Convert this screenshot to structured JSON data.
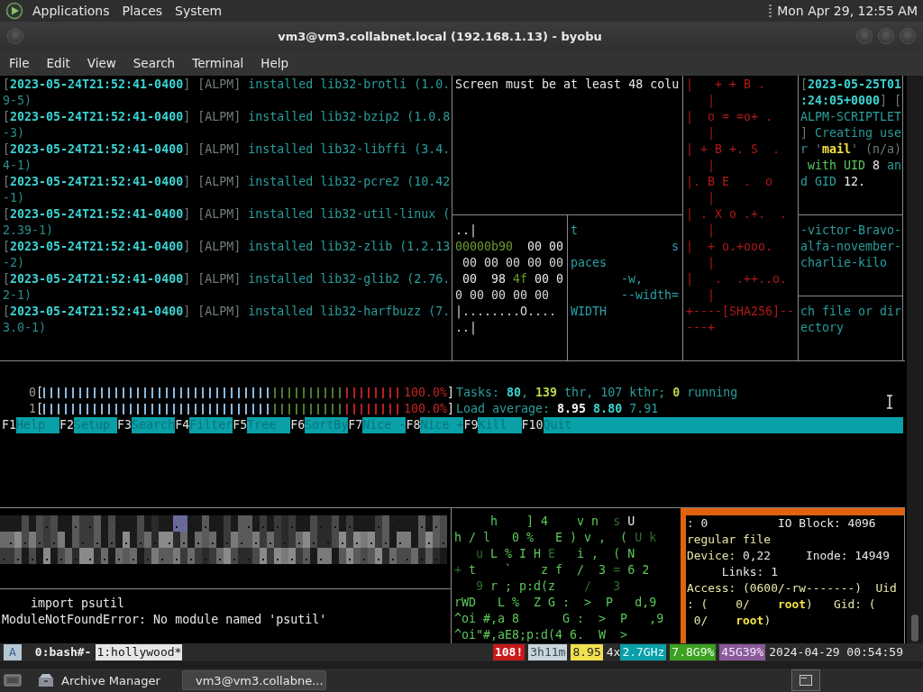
{
  "top_panel": {
    "menus": [
      "Applications",
      "Places",
      "System"
    ],
    "clock": "Mon Apr 29, 12:55 AM"
  },
  "window": {
    "title": "vm3@vm3.collabnet.local (192.168.1.13) - byobu"
  },
  "menu_bar": [
    "File",
    "Edit",
    "View",
    "Search",
    "Terminal",
    "Help"
  ],
  "terminal": {
    "log_pane": {
      "lines": [
        [
          {
            "kind": "grey",
            "text": "["
          },
          {
            "kind": "ts",
            "text": "2023-05-24T21:52:41-0400"
          },
          {
            "kind": "grey",
            "text": "] [ALPM]"
          },
          {
            "kind": "teal",
            "text": " installed lib32-brotli (1.0."
          }
        ],
        "9-5)",
        [
          {
            "kind": "grey",
            "text": "["
          },
          {
            "kind": "ts",
            "text": "2023-05-24T21:52:41-0400"
          },
          {
            "kind": "grey",
            "text": "] [ALPM]"
          },
          {
            "kind": "teal",
            "text": " installed lib32-bzip2 (1.0.8"
          }
        ],
        "-3)",
        [
          {
            "kind": "grey",
            "text": "["
          },
          {
            "kind": "ts",
            "text": "2023-05-24T21:52:41-0400"
          },
          {
            "kind": "grey",
            "text": "] [ALPM]"
          },
          {
            "kind": "teal",
            "text": " installed lib32-libffi (3.4."
          }
        ],
        "4-1)",
        [
          {
            "kind": "grey",
            "text": "["
          },
          {
            "kind": "ts",
            "text": "2023-05-24T21:52:41-0400"
          },
          {
            "kind": "grey",
            "text": "] [ALPM]"
          },
          {
            "kind": "teal",
            "text": " installed lib32-pcre2 (10.42"
          }
        ],
        "-1)",
        [
          {
            "kind": "grey",
            "text": "["
          },
          {
            "kind": "ts",
            "text": "2023-05-24T21:52:41-0400"
          },
          {
            "kind": "grey",
            "text": "] [ALPM]"
          },
          {
            "kind": "teal",
            "text": " installed lib32-util-linux ("
          }
        ],
        "2.39-1)",
        [
          {
            "kind": "grey",
            "text": "["
          },
          {
            "kind": "ts",
            "text": "2023-05-24T21:52:41-0400"
          },
          {
            "kind": "grey",
            "text": "] [ALPM]"
          },
          {
            "kind": "teal",
            "text": " installed lib32-zlib (1.2.13"
          }
        ],
        "-2)",
        [
          {
            "kind": "grey",
            "text": "["
          },
          {
            "kind": "ts",
            "text": "2023-05-24T21:52:41-0400"
          },
          {
            "kind": "grey",
            "text": "] [ALPM]"
          },
          {
            "kind": "teal",
            "text": " installed lib32-glib2 (2.76."
          }
        ],
        "2-1)",
        [
          {
            "kind": "grey",
            "text": "["
          },
          {
            "kind": "ts",
            "text": "2023-05-24T21:52:41-0400"
          },
          {
            "kind": "grey",
            "text": "] [ALPM]"
          },
          {
            "kind": "teal",
            "text": " installed lib32-harfbuzz (7."
          }
        ],
        "3.0-1)"
      ]
    },
    "screen_pane": {
      "lines": [
        "Screen must be at least 48 colu"
      ]
    },
    "hexdump_pane": {
      "lines": [
        "..|",
        [
          {
            "kind": "olive",
            "text": "00000b90"
          },
          {
            "kind": "white",
            "text": "  00 00"
          }
        ],
        " 00 00 00 00 00",
        [
          {
            "kind": "white",
            "text": " 00  98 "
          },
          {
            "kind": "olive",
            "text": "4f"
          },
          {
            "kind": "white",
            "text": " 00 0"
          }
        ],
        "0 00 00 00 00",
        "|........O....",
        "..|"
      ]
    },
    "manpage_pane": {
      "lines": [
        "t",
        "              s",
        "paces",
        "       -w,",
        "       --width=",
        "WIDTH"
      ]
    },
    "randomart_pane": {
      "lines": [
        "|   + + B .",
        "   |",
        "|  o = =o+ .",
        "   |",
        "| + B +. S  .",
        "   |",
        "|. B E  .  o",
        "   |",
        "| . X o .+.  .",
        "   |",
        "|  + o.+ooo.",
        "   |",
        "|   .  .++..o.",
        "   |",
        "+----[SHA256]--",
        "---+"
      ]
    },
    "journal_pane": {
      "lines": [
        [
          {
            "kind": "grey",
            "text": "["
          },
          {
            "kind": "ts",
            "text": "2023-05-25T01"
          }
        ],
        [
          {
            "kind": "ts",
            "text": ":24:05+0000"
          },
          {
            "kind": "grey",
            "text": "] ["
          }
        ],
        "ALPM-SCRIPTLET",
        [
          {
            "kind": "grey",
            "text": "] "
          },
          {
            "kind": "teal",
            "text": "Creating use"
          }
        ],
        [
          {
            "kind": "teal",
            "text": "r "
          },
          {
            "kind": "grey",
            "text": "'"
          },
          {
            "kind": "yellow",
            "text": "mail"
          },
          {
            "kind": "grey",
            "text": "' (n/a)"
          }
        ],
        [
          {
            "kind": "green",
            "text": " with UID "
          },
          {
            "kind": "white",
            "text": "8"
          },
          {
            "kind": "teal",
            "text": " an"
          }
        ],
        [
          {
            "kind": "teal",
            "text": "d GID "
          },
          {
            "kind": "white",
            "text": "12."
          }
        ]
      ]
    },
    "words_pane": {
      "lines": [
        "-victor-Bravo-",
        "alfa-november-",
        "charlie-kilo"
      ]
    },
    "find_pane": {
      "lines": [
        "ch file or dir",
        "ectory"
      ]
    },
    "htop": {
      "cpus": [
        {
          "label": "0",
          "open": "[",
          "reading": "100.0%",
          "close": "]"
        },
        {
          "label": "1",
          "open": "[",
          "reading": "100.0%",
          "close": "]"
        }
      ],
      "summary": [
        [
          {
            "kind": "teal",
            "text": "Tasks: "
          },
          {
            "kind": "ts",
            "text": "80"
          },
          {
            "kind": "teal",
            "text": ", "
          },
          {
            "kind": "lime",
            "text": "139"
          },
          {
            "kind": "teal",
            "text": " thr, 107 kthr; "
          },
          {
            "kind": "lime",
            "text": "0"
          },
          {
            "kind": "teal",
            "text": " running"
          }
        ],
        [
          {
            "kind": "teal",
            "text": "Load average: "
          },
          {
            "kind": "bwhite",
            "text": "8.95"
          },
          {
            "kind": "ts",
            "text": " 8.80"
          },
          {
            "kind": "teal",
            "text": " 7.91"
          }
        ]
      ],
      "function_keys": [
        {
          "key": "F1",
          "label": "Help"
        },
        {
          "key": "F2",
          "label": "Setup"
        },
        {
          "key": "F3",
          "label": "Search"
        },
        {
          "key": "F4",
          "label": "Filter"
        },
        {
          "key": "F5",
          "label": "Tree"
        },
        {
          "key": "F6",
          "label": "SortBy"
        },
        {
          "key": "F7",
          "label": "Nice -"
        },
        {
          "key": "F8",
          "label": "Nice +"
        },
        {
          "key": "F9",
          "label": "Kill"
        },
        {
          "key": "F10",
          "label": "Quit"
        }
      ]
    },
    "python_pane": {
      "lines": [
        "    import psutil",
        "ModuleNotFoundError: No module named 'psutil'"
      ]
    },
    "matrix_pane": {
      "lines": [
        [
          {
            "kind": "green",
            "text": "     h    ] 4    v n  "
          },
          {
            "kind": "dgreen",
            "text": "s"
          },
          {
            "kind": "white",
            "text": " U"
          }
        ],
        [
          {
            "kind": "green",
            "text": "h / l   0 %   E ) v ,  ( "
          },
          {
            "kind": "dgreen",
            "text": "U k"
          }
        ],
        [
          {
            "kind": "dgreen",
            "text": "   u "
          },
          {
            "kind": "green",
            "text": "L % I H "
          },
          {
            "kind": "dgreen",
            "text": "E"
          },
          {
            "kind": "green",
            "text": "   i ,  ( N"
          }
        ],
        [
          {
            "kind": "dgreen",
            "text": "+ "
          },
          {
            "kind": "green",
            "text": "t    `    z f  /  3 "
          },
          {
            "kind": "dgreen",
            "text": "="
          },
          {
            "kind": "green",
            "text": " 6 2"
          }
        ],
        [
          {
            "kind": "dgreen",
            "text": "   9 "
          },
          {
            "kind": "green",
            "text": "r ; p:d(z"
          },
          {
            "kind": "dgreen",
            "text": "    /   3"
          }
        ],
        [
          {
            "kind": "green",
            "text": "rWD   L %  Z G :  >  P   d,9"
          }
        ],
        [
          {
            "kind": "green",
            "text": "^oi #,a 8      G :  >  P   ,9"
          }
        ],
        [
          {
            "kind": "green",
            "text": "^oi\"#,aE8;p:d(4 6.  W  >"
          }
        ]
      ]
    },
    "stat_pane": {
      "lines": [
        [
          {
            "kind": "white",
            "text": ": 0          IO Block: 4096"
          }
        ],
        [
          {
            "kind": "pale",
            "text": "regular file"
          }
        ],
        [
          {
            "kind": "pale",
            "text": "Device:"
          },
          {
            "kind": "white",
            "text": " 0,22     Inode: 14949"
          }
        ],
        [
          {
            "kind": "white",
            "text": "     Links: 1"
          }
        ],
        [
          {
            "kind": "pale",
            "text": "Access: (0600/-rw-------)  Uid"
          }
        ],
        [
          {
            "kind": "pale",
            "text": ": (    0/    "
          },
          {
            "kind": "yellow",
            "text": "root"
          },
          {
            "kind": "pale",
            "text": ")   Gid: ("
          }
        ],
        [
          {
            "kind": "pale",
            "text": " 0/    "
          },
          {
            "kind": "yellow",
            "text": "root"
          },
          {
            "kind": "pale",
            "text": ")"
          }
        ]
      ]
    }
  },
  "status_bar": {
    "session": "A",
    "windows": [
      {
        "label": "0:bash#-",
        "selected": false
      },
      {
        "label": "1:hollywood*",
        "selected": true
      }
    ],
    "indicators": [
      {
        "kind": "alert",
        "text": "108!"
      },
      {
        "kind": "uptime",
        "text": "3h11m"
      },
      {
        "kind": "load",
        "text": "8.95"
      },
      {
        "kind": "plain",
        "text": "4x"
      },
      {
        "kind": "cpu",
        "text": "2.7GHz"
      },
      {
        "kind": "memory",
        "text": "7.8G9%"
      },
      {
        "kind": "disk",
        "text": "45G39%"
      },
      {
        "kind": "plain",
        "text": "2024-04-29 00:54:59"
      }
    ]
  },
  "taskbar": {
    "tasks": [
      {
        "kind": "archive",
        "label": "Archive Manager",
        "selected": false
      },
      {
        "kind": "terminal",
        "label": "vm3@vm3.collabne...",
        "selected": true
      }
    ]
  }
}
